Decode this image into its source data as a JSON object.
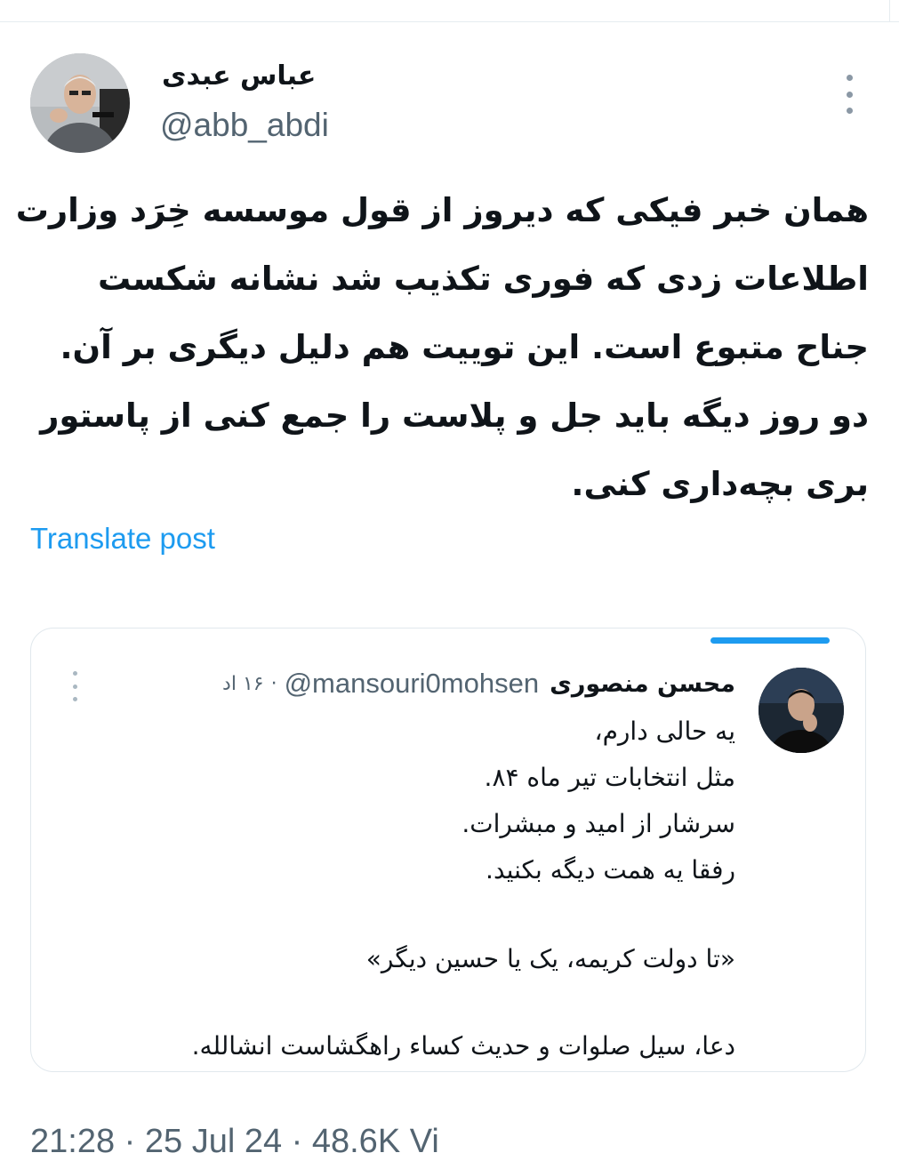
{
  "tweet": {
    "author": {
      "display_name": "عباس عبدی",
      "handle": "@abb_abdi"
    },
    "text_lines": [
      "همان خبر فیکی که دیروز از قول موسسه خِرَد وزارت",
      "اطلاعات زدی که فوری تکذیب شد نشانه شکست",
      "جناح متبوع است. این توییت هم دلیل دیگری بر آن.",
      "دو روز دیگه باید جل و پلاست را جمع کنی از پاستور",
      "بری بچه‌داری کنی."
    ],
    "translate_label": "Translate post",
    "more_icon": "more-vertical-icon",
    "meta_partial": "21:28 · 25 Jul 24 · 48.6K Vi"
  },
  "quote": {
    "author": {
      "display_name": "محسن منصوری",
      "handle": "@mansouri0mohsen",
      "separator": "·",
      "time": "۱۶ اد"
    },
    "body_lines": [
      "یه حالی دارم،",
      "مثل انتخابات تیر ماه ۸۴.",
      "سرشار از امید و مبشرات.",
      "رفقا یه همت دیگه بکنید."
    ],
    "quote_line": "«تا دولت کریمه، یک یا حسین دیگر»",
    "closing_line": "دعا، سیل صلوات و حدیث کساء راهگشاست انشالله."
  },
  "colors": {
    "text": "#0f1419",
    "secondary": "#536471",
    "link": "#1d9bf0",
    "border": "#e1e8ed"
  }
}
